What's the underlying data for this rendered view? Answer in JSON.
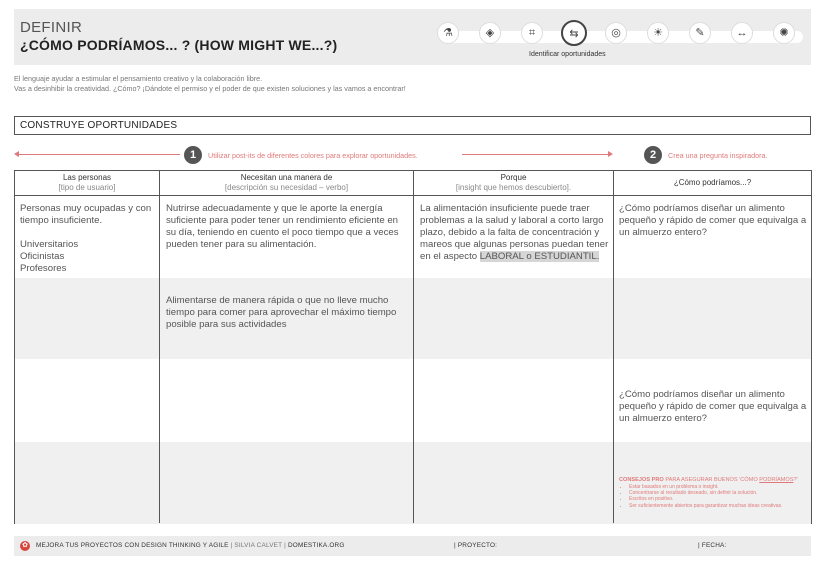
{
  "header": {
    "subtitle": "DEFINIR",
    "title": "¿CÓMO PODRÍAMOS... ? (HOW MIGHT WE...?)",
    "steps_caption": "Identificar oportunidades",
    "step_icons": [
      "flask-icon",
      "shield-icon",
      "target-square-icon",
      "signpost-icon",
      "bullseye-icon",
      "lightbulb-icon",
      "pencil-icon",
      "arrows-icon",
      "sun-icon"
    ],
    "step_glyphs": [
      "⚗",
      "◈",
      "⌗",
      "⇆",
      "◎",
      "☀",
      "✎",
      "↔",
      "✺"
    ],
    "active_step": 3
  },
  "intro": {
    "line1": "El lenguaje ayudar a estimular el pensamiento creativo y la colaboración libre.",
    "line2": "Vas a desinhibir la creatividad. ¿Cómo? ¡Dándote el permiso y el poder de que existen soluciones y las vamos a encontrar!"
  },
  "section": {
    "title": "CONSTRUYE OPORTUNIDADES"
  },
  "instructions": {
    "step1_num": "1",
    "step1_text": "Utilizar post-its de diferentes colores para explorar oportunidades.",
    "step2_num": "2",
    "step2_text": "Crea una pregunta inspiradora."
  },
  "columns": [
    {
      "title": "Las personas",
      "sub": "[tipo de usuario]"
    },
    {
      "title": "Necesitan una manera de",
      "sub": "[descripción su necesidad – verbo]"
    },
    {
      "title": "Porque",
      "sub": "[insight que hemos descubierto]."
    },
    {
      "title": "¿Cómo podríamos...?",
      "sub": ""
    }
  ],
  "cells": {
    "personas_1": "Personas muy ocupadas  y con tiempo insuficiente.",
    "personas_2": "Universitarios",
    "personas_3": "Oficinistas",
    "personas_4": "Profesores",
    "necesitan_1": "Nutrirse adecuadamente y que le aporte la energía suficiente para poder tener un rendimiento eficiente en su día,  teniendo en cuento el poco tiempo que a veces pueden tener para su alimentación.",
    "necesitan_2": "Alimentarse de manera rápida  o que no lleve mucho tiempo para comer para aprovechar el máximo tiempo posible para sus actividades",
    "porque_1": "La alimentación insuficiente puede traer problemas a la salud y laboral a corto largo plazo,  debido a la falta de concentración y mareos que algunas personas puedan tener en el aspecto",
    "porque_1_hl": "LABORAL  o ESTUDIANTIL.",
    "como_1": "¿Cómo podríamos diseñar un alimento pequeño y rápido de comer que equivalga a un almuerzo entero?",
    "como_2": "¿Cómo podríamos diseñar un alimento pequeño y rápido de comer que equivalga a un almuerzo entero?"
  },
  "tips": {
    "title_a": "CONSEJOS PRO",
    "title_b": " PARA ASEGURAR BUENOS 'CÓMO ",
    "title_c": "PODRÍAMOS",
    "title_d": "?'",
    "items": [
      "Estar basados en un problema o insight.",
      "Concentrarse al resultado deseado, sin definir la solución.",
      "Escritos en positivo.",
      "Ser suficientemente abiertos para garantizar muchas ideas creativas."
    ]
  },
  "footer": {
    "logo_glyph": "✿",
    "left_a": "MEJORA TUS PROYECTOS CON DESIGN THINKING Y AGILE",
    "left_sep1": "  |  ",
    "left_b": "SILVIA CALVET",
    "left_sep2": "  |  ",
    "left_c": "DOMESTIKA.ORG",
    "proyecto": "| PROYECTO:",
    "fecha": "| FECHA:"
  }
}
